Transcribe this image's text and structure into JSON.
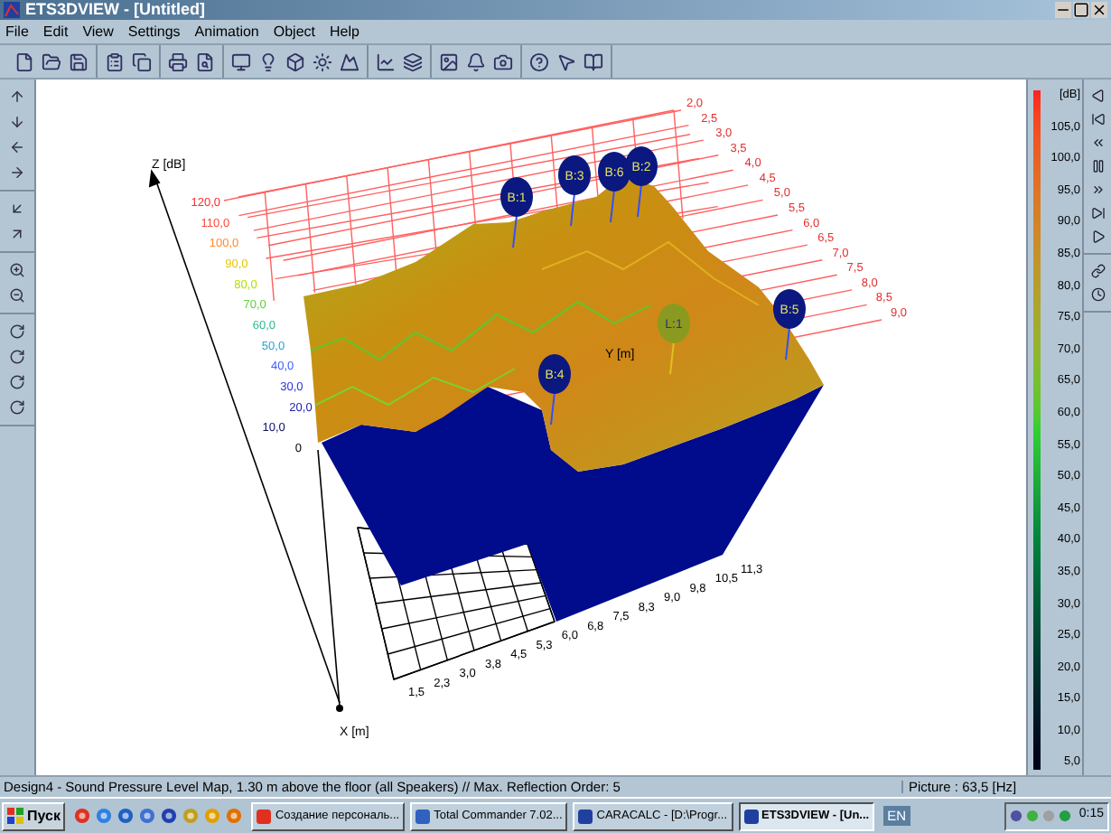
{
  "window": {
    "title": "ETS3DVIEW - [Untitled]"
  },
  "menu": [
    "File",
    "Edit",
    "View",
    "Settings",
    "Animation",
    "Object",
    "Help"
  ],
  "plot": {
    "z_axis_label": "Z [dB]",
    "y_axis_label": "Y [m]",
    "x_axis_label": "X [m]",
    "z_ticks": [
      "120,0",
      "110,0",
      "100,0",
      "90,0",
      "80,0",
      "70,0",
      "60,0",
      "50,0",
      "40,0",
      "30,0",
      "20,0",
      "10,0",
      "0"
    ],
    "y_ticks": [
      "2,0",
      "2,5",
      "3,0",
      "3,5",
      "4,0",
      "4,5",
      "5,0",
      "5,5",
      "6,0",
      "6,5",
      "7,0",
      "7,5",
      "8,0",
      "8,5",
      "9,0"
    ],
    "x_ticks": [
      "1,5",
      "2,3",
      "3,0",
      "3,8",
      "4,5",
      "5,3",
      "6,0",
      "6,8",
      "7,5",
      "8,3",
      "9,0",
      "9,8",
      "10,5",
      "11,3"
    ],
    "markers": [
      {
        "label": "B:1",
        "kind": "speaker"
      },
      {
        "label": "B:3",
        "kind": "speaker"
      },
      {
        "label": "B:6",
        "kind": "speaker"
      },
      {
        "label": "B:2",
        "kind": "speaker"
      },
      {
        "label": "B:5",
        "kind": "speaker"
      },
      {
        "label": "B:4",
        "kind": "speaker"
      },
      {
        "label": "L:1",
        "kind": "listener"
      }
    ]
  },
  "scale": {
    "unit": "[dB]",
    "ticks": [
      "105,0",
      "100,0",
      "95,0",
      "90,0",
      "85,0",
      "80,0",
      "75,0",
      "70,0",
      "65,0",
      "60,0",
      "55,0",
      "50,0",
      "45,0",
      "40,0",
      "35,0",
      "30,0",
      "25,0",
      "20,0",
      "15,0",
      "10,0",
      "5,0"
    ]
  },
  "status_bar": {
    "description": "Design4 - Sound Pressure Level Map, 1.30 m above the floor (all Speakers) // Max. Reflection Order: 5",
    "picture": "Picture : 63,5 [Hz]"
  },
  "taskbar": {
    "start": "Пуск",
    "tasks": [
      {
        "label": "Создание персональ...",
        "selected": false
      },
      {
        "label": "Total Commander 7.02...",
        "selected": false
      },
      {
        "label": "CARACALC - [D:\\Progr...",
        "selected": false
      },
      {
        "label": "ETS3DVIEW - [Un...",
        "selected": true
      }
    ],
    "language": "EN",
    "clock": "0:15"
  }
}
